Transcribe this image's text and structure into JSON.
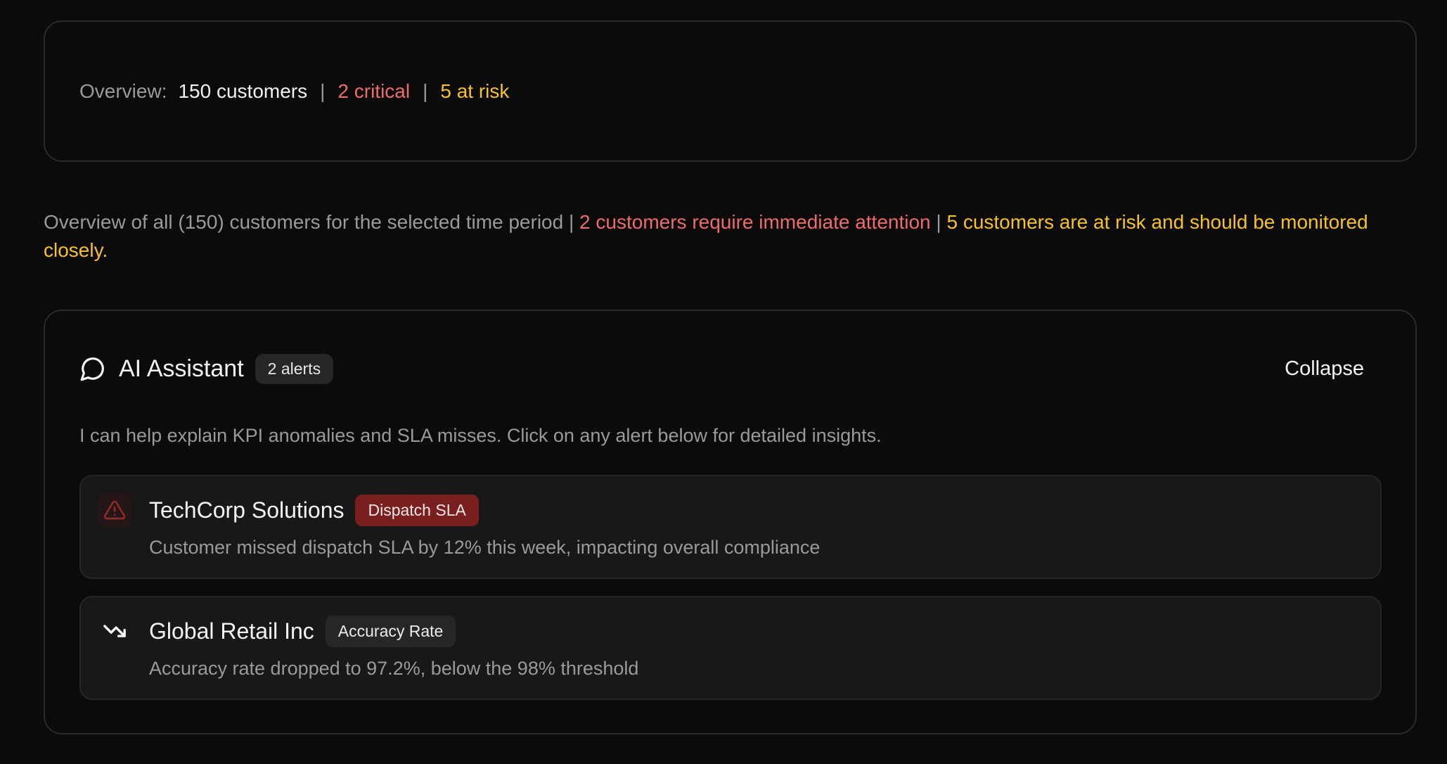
{
  "summary": {
    "label": "Overview:",
    "total": "150 customers",
    "separator": "|",
    "critical": "2 critical",
    "at_risk": "5 at risk"
  },
  "description": {
    "main": "Overview of all (150) customers for the selected time period",
    "sep": " | ",
    "critical": "2 customers require immediate attention",
    "risk": "5 customers are at risk and should be monitored closely."
  },
  "assistant": {
    "title": "AI Assistant",
    "badge": "2 alerts",
    "collapse_label": "Collapse",
    "intro": "I can help explain KPI anomalies and SLA misses. Click on any alert below for detailed insights.",
    "alerts": [
      {
        "icon": "warning-triangle-icon",
        "name": "TechCorp Solutions",
        "tag": "Dispatch SLA",
        "tag_color": "#7a1f1f",
        "description": "Customer missed dispatch SLA by 12% this week, impacting overall compliance"
      },
      {
        "icon": "trending-down-icon",
        "name": "Global Retail Inc",
        "tag": "Accuracy Rate",
        "tag_color": "#262626",
        "description": "Accuracy rate dropped to 97.2%, below the 98% threshold"
      }
    ]
  },
  "colors": {
    "critical": "#ee6b6b",
    "risk": "#f5c228",
    "background": "#0b0b0b",
    "card_border": "#2a2a2a"
  }
}
